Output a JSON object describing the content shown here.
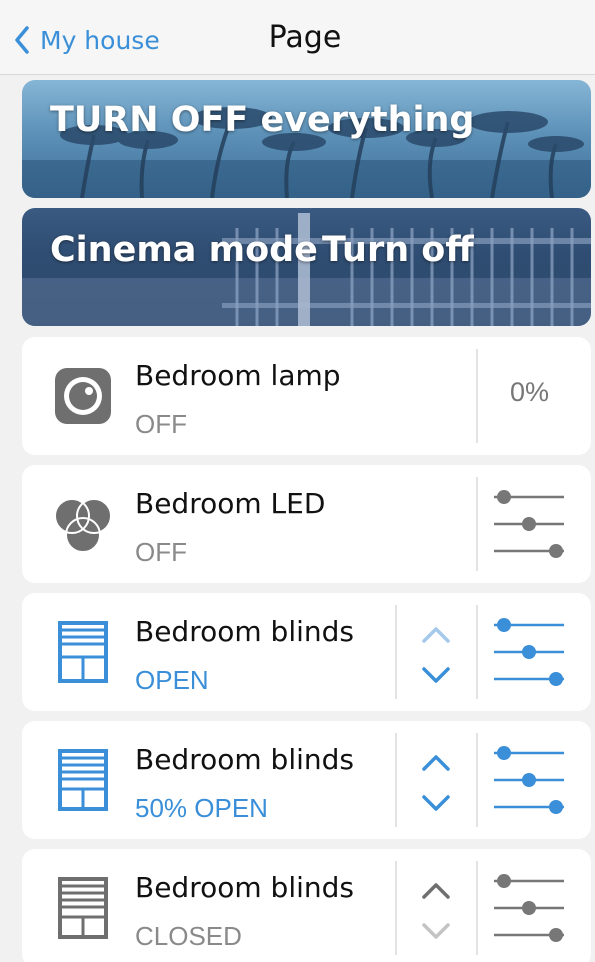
{
  "header": {
    "back_label": "My house",
    "title": "Page"
  },
  "scenes": [
    {
      "label": "TURN OFF everything"
    },
    {
      "label": "Cinema mode",
      "label2": "Turn off"
    }
  ],
  "devices": [
    {
      "name": "Bedroom lamp",
      "state": "OFF",
      "value": "0%"
    },
    {
      "name": "Bedroom LED",
      "state": "OFF"
    },
    {
      "name": "Bedroom blinds",
      "state": "OPEN"
    },
    {
      "name": "Bedroom blinds",
      "state": "50% OPEN"
    },
    {
      "name": "Bedroom blinds",
      "state": "CLOSED"
    }
  ],
  "colors": {
    "accent": "#3a8fd8",
    "inactive": "#8a8a8a",
    "background": "#f1f1f2"
  }
}
